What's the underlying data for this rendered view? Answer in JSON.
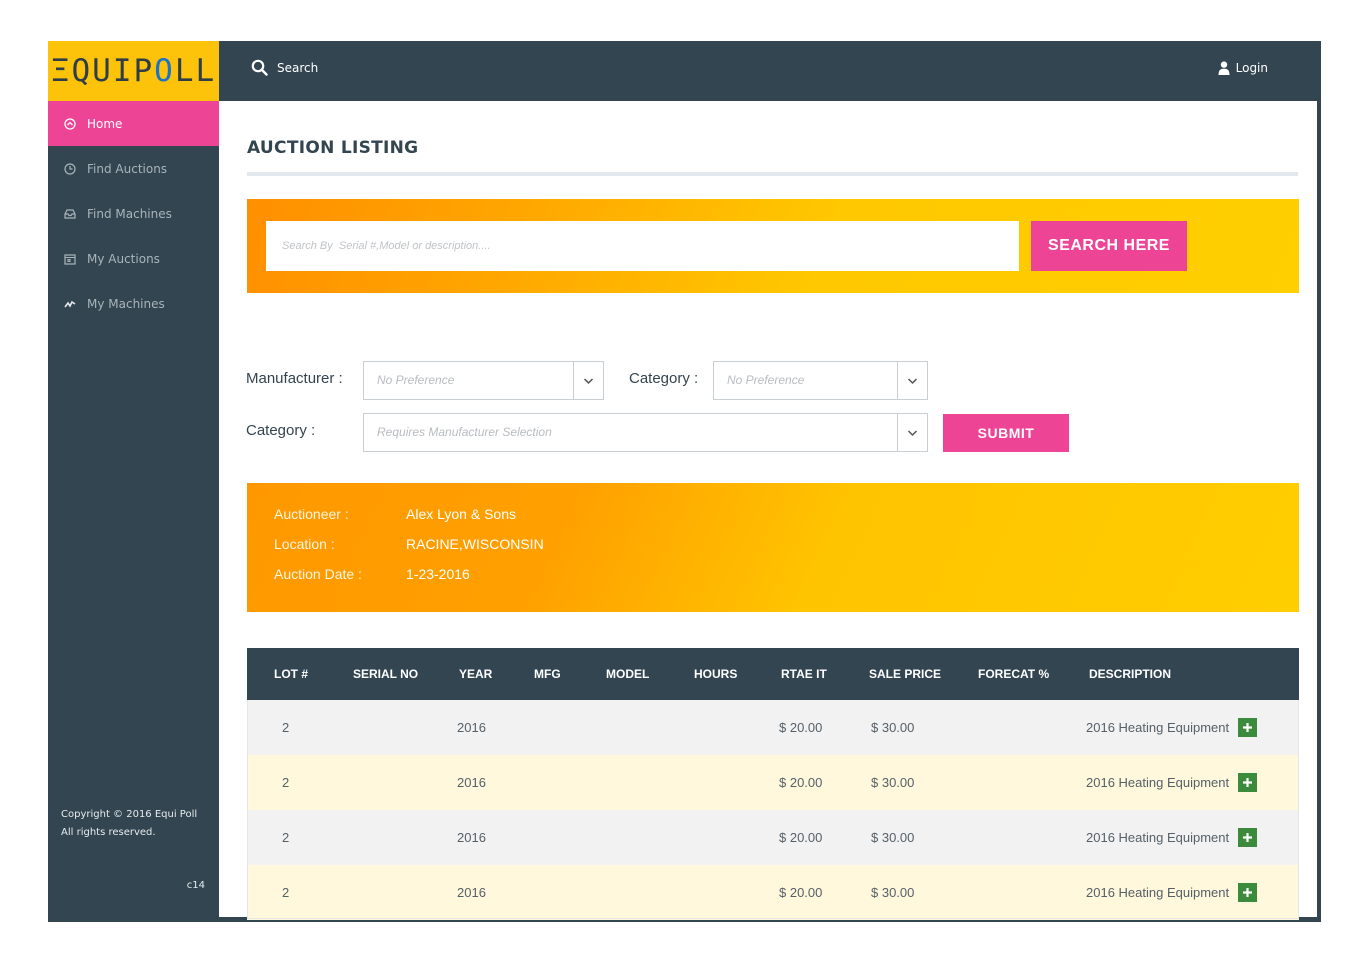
{
  "brand": {
    "logo_pre": "ΞQUIP",
    "logo_accent": "O",
    "logo_post": "LL"
  },
  "sidebar": {
    "items": [
      {
        "label": "Home",
        "icon": "home-icon",
        "active": true
      },
      {
        "label": "Find Auctions",
        "icon": "clock-icon"
      },
      {
        "label": "Find Machines",
        "icon": "tray-icon"
      },
      {
        "label": "My Auctions",
        "icon": "calendar-icon"
      },
      {
        "label": "My Machines",
        "icon": "chart-line-icon"
      }
    ],
    "copyright_1": "Copyright © 2016 Equi Poll",
    "copyright_2": "All rights reserved.",
    "version": "c14"
  },
  "topbar": {
    "search_label": "Search",
    "login_label": "Login"
  },
  "page": {
    "title": "AUCTION LISTING"
  },
  "search": {
    "placeholder": "Search By  Serial #,Model or description....",
    "button_label": "SEARCH HERE"
  },
  "filters": {
    "manufacturer_label": "Manufacturer :",
    "manufacturer_value": "No Preference",
    "category_label": "Category :",
    "category_value": "No Preference",
    "category2_label": "Category :",
    "category2_value": "Requires Manufacturer Selection",
    "submit_label": "SUBMIT"
  },
  "auction": {
    "auctioneer_label": "Auctioneer :",
    "auctioneer": "Alex Lyon & Sons",
    "location_label": "Location :",
    "location": "RACINE,WISCONSIN",
    "date_label": "Auction Date :",
    "date": "1-23-2016"
  },
  "table": {
    "headers": [
      "LOT #",
      "SERIAL NO",
      "YEAR",
      "MFG",
      "MODEL",
      "HOURS",
      "RTAE IT",
      "SALE PRICE",
      "FORECAT %",
      "DESCRIPTION"
    ],
    "rows": [
      {
        "lot": "2",
        "year": "2016",
        "rate": "$ 20.00",
        "sale": "$ 30.00",
        "description": "2016 Heating Equipment"
      },
      {
        "lot": "2",
        "year": "2016",
        "rate": "$ 20.00",
        "sale": "$ 30.00",
        "description": "2016 Heating Equipment"
      },
      {
        "lot": "2",
        "year": "2016",
        "rate": "$ 20.00",
        "sale": "$ 30.00",
        "description": "2016 Heating Equipment"
      },
      {
        "lot": "2",
        "year": "2016",
        "rate": "$ 20.00",
        "sale": "$ 30.00",
        "description": "2016 Heating Equipment"
      }
    ]
  },
  "colors": {
    "primary": "#334550",
    "accent_pink": "#ee4496",
    "logo_yellow": "#fcc30a",
    "plus_green": "#3c8a3c"
  }
}
